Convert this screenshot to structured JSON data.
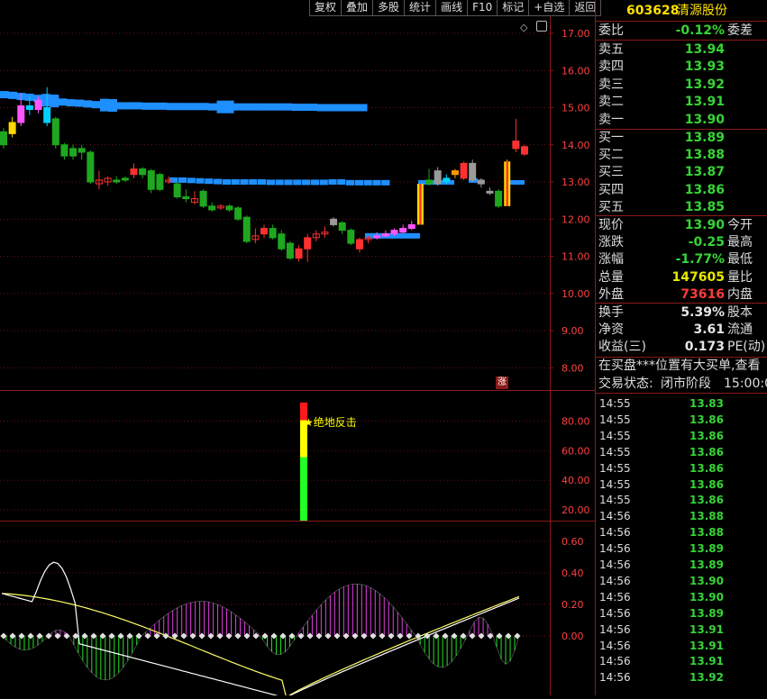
{
  "toolbar": [
    "复权",
    "叠加",
    "多股",
    "统计",
    "画线",
    "F10",
    "标记",
    "+自选",
    "返回"
  ],
  "stock": {
    "code": "603628",
    "name": "清源股份"
  },
  "colors": {
    "up": "#ff3b3b",
    "down": "#36d436",
    "ma": "#1e8fff",
    "cyan": "#00d0ff",
    "magenta": "#ff55ff",
    "yellow": "#e8e800",
    "grid": "#8b1a1a"
  },
  "price_axis": [
    "17.00",
    "16.00",
    "15.00",
    "14.00",
    "13.00",
    "12.00",
    "11.00",
    "10.00",
    "9.00",
    "8.00"
  ],
  "indicator_axis": [
    "80.00",
    "60.00",
    "40.00",
    "20.00"
  ],
  "macd_axis": [
    "0.60",
    "0.40",
    "0.20",
    "0.00"
  ],
  "zhang_label": "涨",
  "signal_label": "★绝地反击",
  "quote": {
    "weibi_label": "委比",
    "weibi_value": "-0.12%",
    "weicha_label": "委差",
    "asks": [
      {
        "label": "卖五",
        "price": "13.94"
      },
      {
        "label": "卖四",
        "price": "13.93"
      },
      {
        "label": "卖三",
        "price": "13.92"
      },
      {
        "label": "卖二",
        "price": "13.91"
      },
      {
        "label": "卖一",
        "price": "13.90"
      }
    ],
    "bids": [
      {
        "label": "买一",
        "price": "13.89"
      },
      {
        "label": "买二",
        "price": "13.88"
      },
      {
        "label": "买三",
        "price": "13.87"
      },
      {
        "label": "买四",
        "price": "13.86"
      },
      {
        "label": "买五",
        "price": "13.85"
      }
    ],
    "stats": [
      {
        "label": "现价",
        "value": "13.90",
        "color": "green",
        "right": "今开"
      },
      {
        "label": "涨跌",
        "value": "-0.25",
        "color": "green",
        "right": "最高"
      },
      {
        "label": "涨幅",
        "value": "-1.77%",
        "color": "green",
        "right": "最低"
      },
      {
        "label": "总量",
        "value": "147605",
        "color": "yellow",
        "right": "量比"
      },
      {
        "label": "外盘",
        "value": "73616",
        "color": "red",
        "right": "内盘"
      }
    ],
    "fundamentals": [
      {
        "label": "换手",
        "value": "5.39%",
        "right": "股本"
      },
      {
        "label": "净资",
        "value": "3.61",
        "right": "流通"
      },
      {
        "label": "收益(三)",
        "value": "0.173",
        "right": "PE(动)"
      }
    ],
    "notice": "在买盘***位置有大买单,查看",
    "trade_status_label": "交易状态:",
    "trade_status_value": "闭市阶段",
    "trade_status_time": "15:00:0"
  },
  "ticks": [
    {
      "time": "14:55",
      "price": "13.83"
    },
    {
      "time": "14:55",
      "price": "13.86"
    },
    {
      "time": "14:55",
      "price": "13.86"
    },
    {
      "time": "14:55",
      "price": "13.86"
    },
    {
      "time": "14:55",
      "price": "13.86"
    },
    {
      "time": "14:55",
      "price": "13.86"
    },
    {
      "time": "14:55",
      "price": "13.86"
    },
    {
      "time": "14:56",
      "price": "13.88"
    },
    {
      "time": "14:56",
      "price": "13.88"
    },
    {
      "time": "14:56",
      "price": "13.89"
    },
    {
      "time": "14:56",
      "price": "13.89"
    },
    {
      "time": "14:56",
      "price": "13.90"
    },
    {
      "time": "14:56",
      "price": "13.90"
    },
    {
      "time": "14:56",
      "price": "13.89"
    },
    {
      "time": "14:56",
      "price": "13.91"
    },
    {
      "time": "14:56",
      "price": "13.91"
    },
    {
      "time": "14:56",
      "price": "13.91"
    },
    {
      "time": "14:56",
      "price": "13.92"
    }
  ],
  "chart_data": {
    "type": "candlestick",
    "price_ylim": [
      7.6,
      17.4
    ],
    "candles": [
      {
        "o": 14.0,
        "c": 14.35,
        "h": 14.45,
        "l": 13.9,
        "col": "green"
      },
      {
        "o": 14.3,
        "c": 14.6,
        "h": 14.75,
        "l": 14.2,
        "col": "yellow"
      },
      {
        "o": 14.6,
        "c": 15.05,
        "h": 15.4,
        "l": 14.5,
        "col": "magenta"
      },
      {
        "o": 15.05,
        "c": 14.95,
        "h": 15.3,
        "l": 14.8,
        "col": "cyan"
      },
      {
        "o": 14.95,
        "c": 15.2,
        "h": 15.3,
        "l": 14.85,
        "col": "magenta"
      },
      {
        "o": 15.0,
        "c": 14.6,
        "h": 15.55,
        "l": 14.5,
        "col": "cyan"
      },
      {
        "o": 14.7,
        "c": 14.0,
        "h": 14.75,
        "l": 13.9,
        "col": "green"
      },
      {
        "o": 14.0,
        "c": 13.7,
        "h": 14.05,
        "l": 13.6,
        "col": "green"
      },
      {
        "o": 13.9,
        "c": 13.7,
        "h": 14.0,
        "l": 13.6,
        "col": "green"
      },
      {
        "o": 13.9,
        "c": 13.8,
        "h": 14.0,
        "l": 13.6,
        "col": "green"
      },
      {
        "o": 13.8,
        "c": 13.0,
        "h": 13.85,
        "l": 12.95,
        "col": "green"
      },
      {
        "o": 12.95,
        "c": 13.05,
        "h": 13.3,
        "l": 12.8,
        "col": "red"
      },
      {
        "o": 13.0,
        "c": 13.1,
        "h": 13.15,
        "l": 12.9,
        "col": "red"
      },
      {
        "o": 13.05,
        "c": 13.0,
        "h": 13.15,
        "l": 12.95,
        "col": "green"
      },
      {
        "o": 13.05,
        "c": 13.1,
        "h": 13.15,
        "l": 13.0,
        "col": "green"
      },
      {
        "o": 13.2,
        "c": 13.35,
        "h": 13.5,
        "l": 13.1,
        "col": "red"
      },
      {
        "o": 13.35,
        "c": 13.2,
        "h": 13.4,
        "l": 13.1,
        "col": "green"
      },
      {
        "o": 13.3,
        "c": 12.8,
        "h": 13.35,
        "l": 12.7,
        "col": "green"
      },
      {
        "o": 12.8,
        "c": 13.2,
        "h": 13.25,
        "l": 12.75,
        "col": "green"
      },
      {
        "o": 13.0,
        "c": 13.05,
        "h": 13.15,
        "l": 12.95,
        "col": "red"
      },
      {
        "o": 12.95,
        "c": 12.6,
        "h": 13.0,
        "l": 12.55,
        "col": "green"
      },
      {
        "o": 12.6,
        "c": 12.55,
        "h": 12.8,
        "l": 12.45,
        "col": "green"
      },
      {
        "o": 12.55,
        "c": 12.45,
        "h": 12.75,
        "l": 12.4,
        "col": "red"
      },
      {
        "o": 12.75,
        "c": 12.35,
        "h": 12.8,
        "l": 12.3,
        "col": "green"
      },
      {
        "o": 12.35,
        "c": 12.25,
        "h": 12.45,
        "l": 12.2,
        "col": "green"
      },
      {
        "o": 12.3,
        "c": 12.35,
        "h": 12.4,
        "l": 12.25,
        "col": "red"
      },
      {
        "o": 12.35,
        "c": 12.25,
        "h": 12.4,
        "l": 12.2,
        "col": "green"
      },
      {
        "o": 12.3,
        "c": 12.0,
        "h": 12.35,
        "l": 11.95,
        "col": "green"
      },
      {
        "o": 12.05,
        "c": 11.4,
        "h": 12.1,
        "l": 11.35,
        "col": "green"
      },
      {
        "o": 11.45,
        "c": 11.55,
        "h": 11.75,
        "l": 11.35,
        "col": "red"
      },
      {
        "o": 11.6,
        "c": 11.75,
        "h": 11.85,
        "l": 11.5,
        "col": "red"
      },
      {
        "o": 11.75,
        "c": 11.5,
        "h": 11.85,
        "l": 11.45,
        "col": "green"
      },
      {
        "o": 11.6,
        "c": 11.2,
        "h": 11.7,
        "l": 11.15,
        "col": "green"
      },
      {
        "o": 11.35,
        "c": 10.95,
        "h": 11.4,
        "l": 10.9,
        "col": "green"
      },
      {
        "o": 10.95,
        "c": 11.2,
        "h": 11.3,
        "l": 10.85,
        "col": "red"
      },
      {
        "o": 11.2,
        "c": 11.5,
        "h": 11.6,
        "l": 10.85,
        "col": "red"
      },
      {
        "o": 11.5,
        "c": 11.6,
        "h": 11.7,
        "l": 11.4,
        "col": "red"
      },
      {
        "o": 11.6,
        "c": 11.65,
        "h": 11.8,
        "l": 11.5,
        "col": "red"
      },
      {
        "o": 12.0,
        "c": 11.85,
        "h": 12.05,
        "l": 11.8,
        "col": "gray"
      },
      {
        "o": 11.9,
        "c": 11.7,
        "h": 11.95,
        "l": 11.6,
        "col": "green"
      },
      {
        "o": 11.7,
        "c": 11.35,
        "h": 11.75,
        "l": 11.3,
        "col": "green"
      },
      {
        "o": 11.2,
        "c": 11.45,
        "h": 11.5,
        "l": 11.1,
        "col": "red"
      },
      {
        "o": 11.45,
        "c": 11.5,
        "h": 11.55,
        "l": 11.35,
        "col": "red"
      },
      {
        "o": 11.5,
        "c": 11.55,
        "h": 11.65,
        "l": 11.45,
        "col": "magenta"
      },
      {
        "o": 11.55,
        "c": 11.6,
        "h": 11.7,
        "l": 11.5,
        "col": "magenta"
      },
      {
        "o": 11.6,
        "c": 11.7,
        "h": 11.75,
        "l": 11.55,
        "col": "magenta"
      },
      {
        "o": 11.65,
        "c": 11.75,
        "h": 11.85,
        "l": 11.6,
        "col": "magenta"
      },
      {
        "o": 11.75,
        "c": 11.85,
        "h": 11.95,
        "l": 11.7,
        "col": "magenta"
      },
      {
        "o": 11.85,
        "c": 12.95,
        "h": 12.95,
        "l": 11.85,
        "col": "mixed"
      },
      {
        "o": 12.95,
        "c": 13.05,
        "h": 13.35,
        "l": 12.9,
        "col": "green"
      },
      {
        "o": 13.3,
        "c": 12.95,
        "h": 13.4,
        "l": 12.9,
        "col": "gray"
      },
      {
        "o": 13.0,
        "c": 13.1,
        "h": 13.2,
        "l": 12.95,
        "col": "cyan"
      },
      {
        "o": 13.2,
        "c": 13.3,
        "h": 13.35,
        "l": 13.1,
        "col": "orange"
      },
      {
        "o": 13.1,
        "c": 13.5,
        "h": 13.55,
        "l": 13.05,
        "col": "red"
      },
      {
        "o": 13.5,
        "c": 13.05,
        "h": 13.6,
        "l": 13.0,
        "col": "gray"
      },
      {
        "o": 13.05,
        "c": 12.95,
        "h": 13.1,
        "l": 12.85,
        "col": "gray"
      },
      {
        "o": 12.75,
        "c": 12.7,
        "h": 12.85,
        "l": 12.65,
        "col": "gray"
      },
      {
        "o": 12.75,
        "c": 12.35,
        "h": 12.8,
        "l": 12.3,
        "col": "green"
      },
      {
        "o": 12.35,
        "c": 13.55,
        "h": 13.6,
        "l": 12.35,
        "col": "mixed"
      },
      {
        "o": 13.9,
        "c": 14.1,
        "h": 14.7,
        "l": 13.8,
        "col": "red"
      },
      {
        "o": 13.95,
        "c": 13.75,
        "h": 14.0,
        "l": 13.7,
        "col": "red"
      }
    ],
    "ma_upper": [
      15.35,
      15.33,
      15.3,
      15.28,
      15.25,
      15.2,
      15.18,
      15.15,
      15.13,
      15.12,
      15.1,
      15.08,
      15.07,
      15.06,
      15.05,
      15.05,
      15.05,
      15.04,
      15.04,
      15.04,
      15.03,
      15.03,
      15.03,
      15.03,
      15.03,
      15.02,
      15.02,
      15.02,
      15.02,
      15.02,
      15.02,
      15.02,
      15.02,
      15.02,
      15.02,
      15.01,
      15.01,
      15.01,
      15.0,
      15.0,
      15.0,
      15.0,
      15.0,
      15.0
    ],
    "ma_lower": [
      13.05,
      13.05,
      13.04,
      13.03,
      13.02,
      13.01,
      13.0,
      13.0,
      13.0,
      13.0,
      13.0,
      12.99,
      12.99,
      12.99,
      12.99,
      12.99,
      12.99,
      12.99,
      13.0,
      13.0,
      12.98,
      12.98,
      12.98,
      12.98,
      12.98
    ],
    "volume_signal": {
      "red": [
        80,
        90
      ],
      "yellow": [
        40,
        80
      ],
      "green": [
        20,
        40
      ]
    },
    "indicator_ylim": [
      12,
      98
    ],
    "macd_ylim": [
      -0.45,
      0.72
    ]
  }
}
